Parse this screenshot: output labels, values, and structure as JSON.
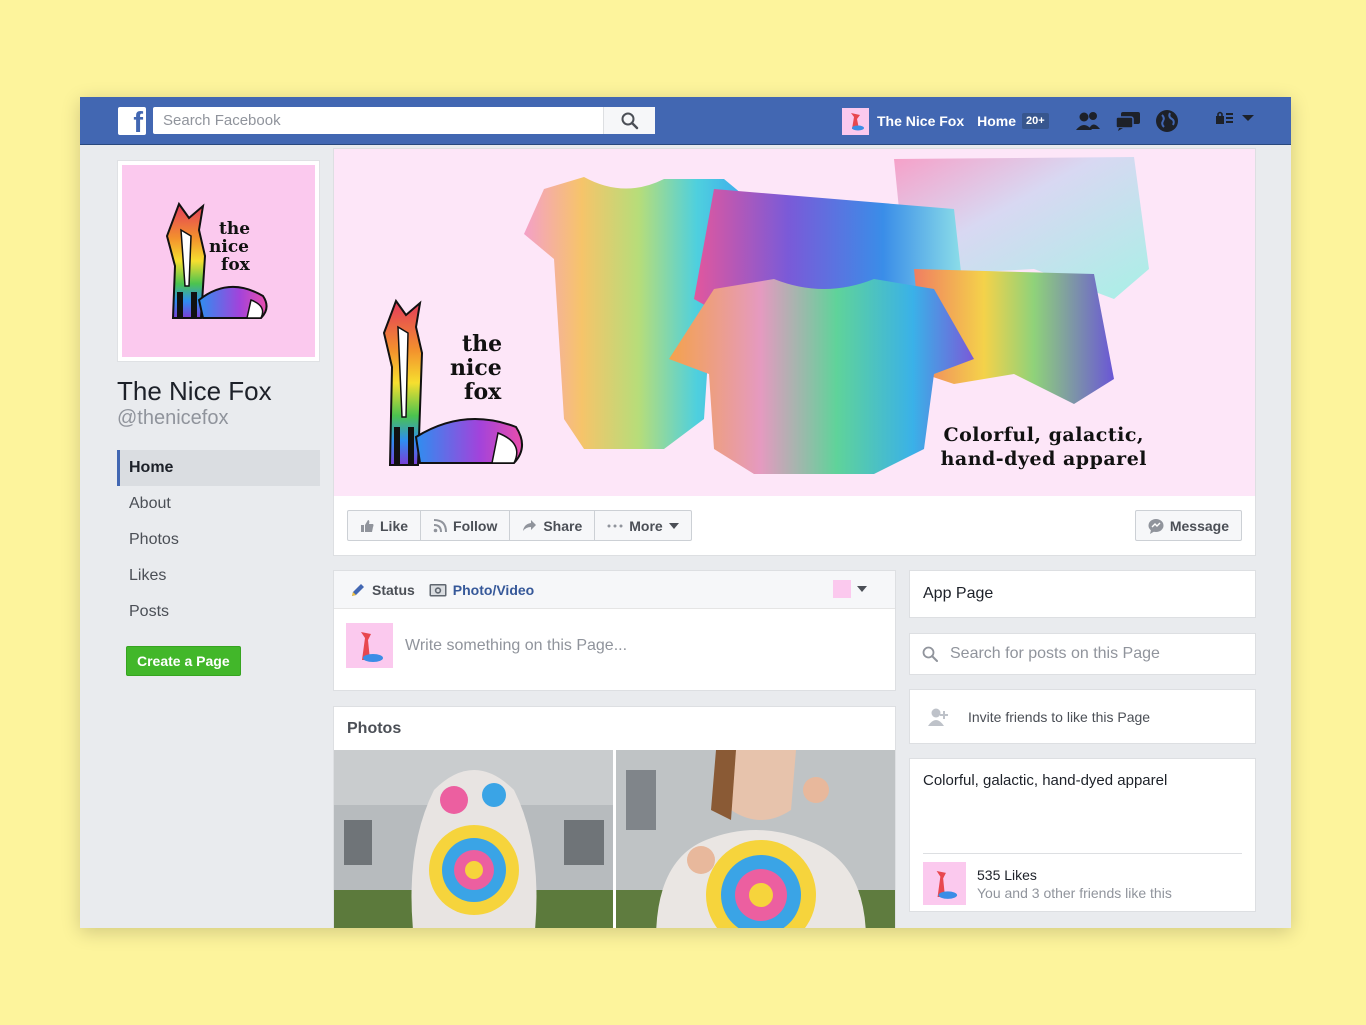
{
  "topbar": {
    "logo": "f",
    "search_placeholder": "Search Facebook",
    "page_name": "The Nice Fox",
    "home_label": "Home",
    "notification_count": "20+"
  },
  "profile": {
    "logo_words": [
      "the",
      "nice",
      "fox"
    ],
    "name": "The Nice Fox",
    "handle": "@thenicefox"
  },
  "sidebar": {
    "items": [
      {
        "label": "Home",
        "active": true
      },
      {
        "label": "About"
      },
      {
        "label": "Photos"
      },
      {
        "label": "Likes"
      },
      {
        "label": "Posts"
      }
    ],
    "create_page_label": "Create a Page"
  },
  "cover": {
    "logo_words": [
      "the",
      "nice",
      "fox"
    ],
    "tagline_line1": "Colorful, galactic,",
    "tagline_line2": "hand-dyed apparel"
  },
  "actions": {
    "like": "Like",
    "follow": "Follow",
    "share": "Share",
    "more": "More",
    "message": "Message"
  },
  "composer": {
    "status_tab": "Status",
    "photo_tab": "Photo/Video",
    "placeholder": "Write something on this Page..."
  },
  "photos": {
    "title": "Photos"
  },
  "right": {
    "app_page": "App Page",
    "search_placeholder": "Search for posts on this Page",
    "invite": "Invite friends to like this Page",
    "about": "Colorful, galactic, hand-dyed apparel",
    "likes_count": "535 Likes",
    "likes_friends": "You and 3 other friends like this"
  },
  "colors": {
    "brand_blue": "#4267b2",
    "create_green": "#42b72a",
    "logo_pink": "#fbc9ee",
    "cover_pink": "#fde6f8"
  },
  "icons": [
    "facebook-logo-icon",
    "search-icon",
    "friends-icon",
    "messages-icon",
    "globe-icon",
    "lock-menu-icon",
    "thumbs-up-icon",
    "rss-icon",
    "share-arrow-icon",
    "dots-icon",
    "messenger-icon",
    "pencil-icon",
    "camera-icon",
    "add-friend-icon"
  ]
}
